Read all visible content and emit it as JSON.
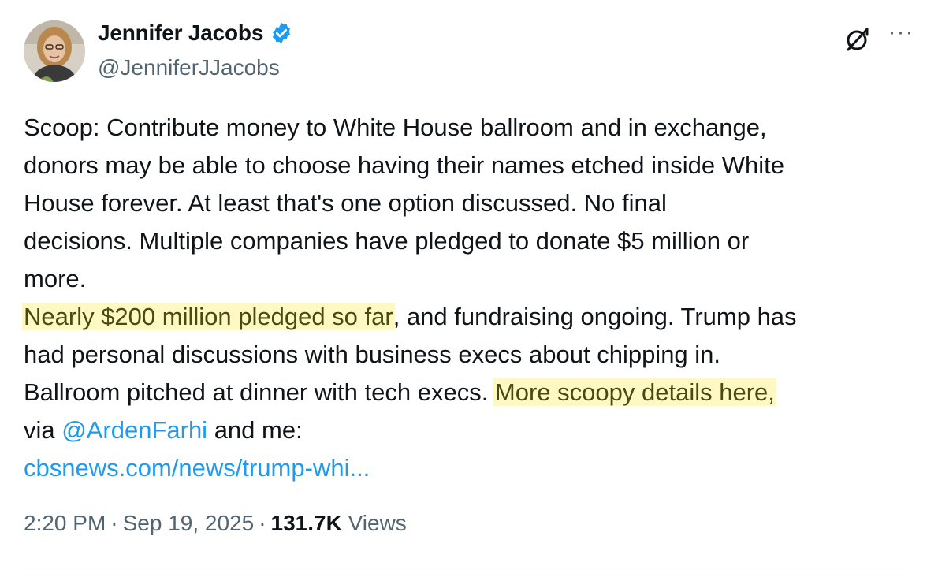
{
  "author": {
    "display_name": "Jennifer Jacobs",
    "handle": "@JenniferJJacobs",
    "verified": true,
    "verified_color": "#1d9bf0"
  },
  "icons": {
    "grok": "grok-icon",
    "more": "more-icon",
    "more_glyph": "···",
    "verified": "verified-badge-icon"
  },
  "body": {
    "lines": [
      "Scoop: Contribute money to White House ballroom and in exchange,",
      "donors may be able to choose having their names etched inside White",
      "House forever. At least that's one option discussed. No final",
      "decisions. Multiple companies have pledged to donate $5 million or",
      "more."
    ],
    "highlight_1": "Nearly $200 million pledged so far",
    "after_highlight_1": ", and fundraising ongoing. Trump has",
    "line_7": "had personal discussions with business execs about chipping in.",
    "line_8_start": "Ballroom pitched at dinner with tech execs. ",
    "highlight_2": "More scoopy details here,",
    "via_prefix": "via ",
    "mention": "@ArdenFarhi",
    "via_suffix": " and me:",
    "url": "cbsnews.com/news/trump-whi..."
  },
  "meta": {
    "time": "2:20 PM",
    "date": "Sep 19, 2025",
    "views_count": "131.7K",
    "views_label": "Views",
    "separator": "·"
  },
  "colors": {
    "text": "#0f1419",
    "secondary": "#536471",
    "link": "#1d9bf0",
    "highlight": "#fdf8c4"
  }
}
